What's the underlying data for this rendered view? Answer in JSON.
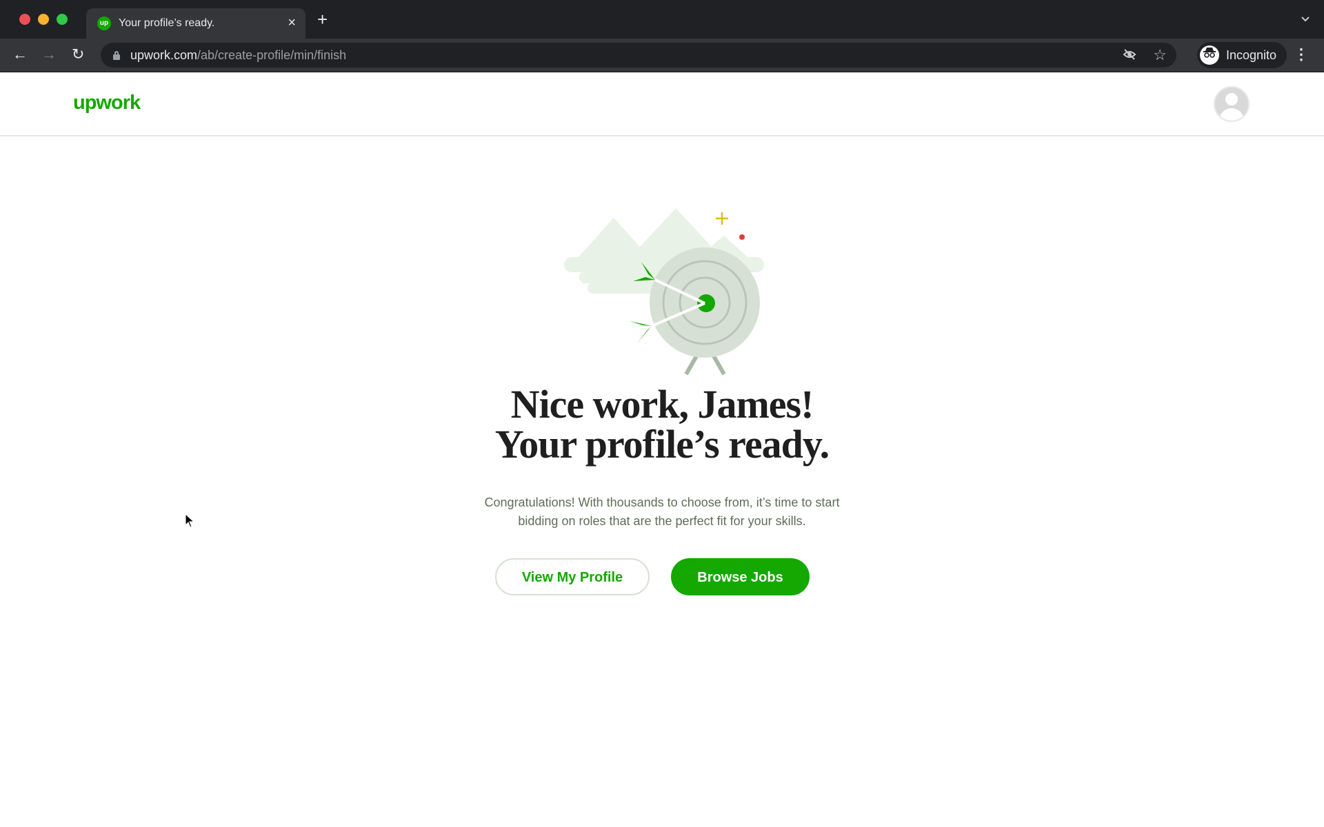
{
  "browser": {
    "tab": {
      "favicon_text": "up",
      "title": "Your profile’s ready.",
      "close_glyph": "×"
    },
    "new_tab_glyph": "+",
    "tab_list_glyph": "⌄",
    "nav": {
      "back_glyph": "←",
      "forward_glyph": "→",
      "reload_glyph": "↻"
    },
    "address": {
      "host": "upwork.com",
      "path": "/ab/create-profile/min/finish"
    },
    "eye_glyph": "⊘",
    "star_glyph": "☆",
    "profile": {
      "icon_glyph": "👓",
      "label": "Incognito"
    },
    "menu_glyph": "⋮"
  },
  "header": {
    "logo": "upwork"
  },
  "main": {
    "headline_line1": "Nice work, James!",
    "headline_line2": "Your profile’s ready.",
    "subtext_line1": "Congratulations! With thousands to choose from, it’s time to start",
    "subtext_line2": "bidding on roles that are the perfect fit for your skills.",
    "buttons": {
      "secondary": "View My Profile",
      "primary": "Browse Jobs"
    }
  },
  "colors": {
    "brand_green": "#14a800",
    "chrome_dark": "#202124",
    "chrome_toolbar": "#35363a",
    "headline": "#1f1f1f",
    "subtext": "#5e6d55"
  }
}
